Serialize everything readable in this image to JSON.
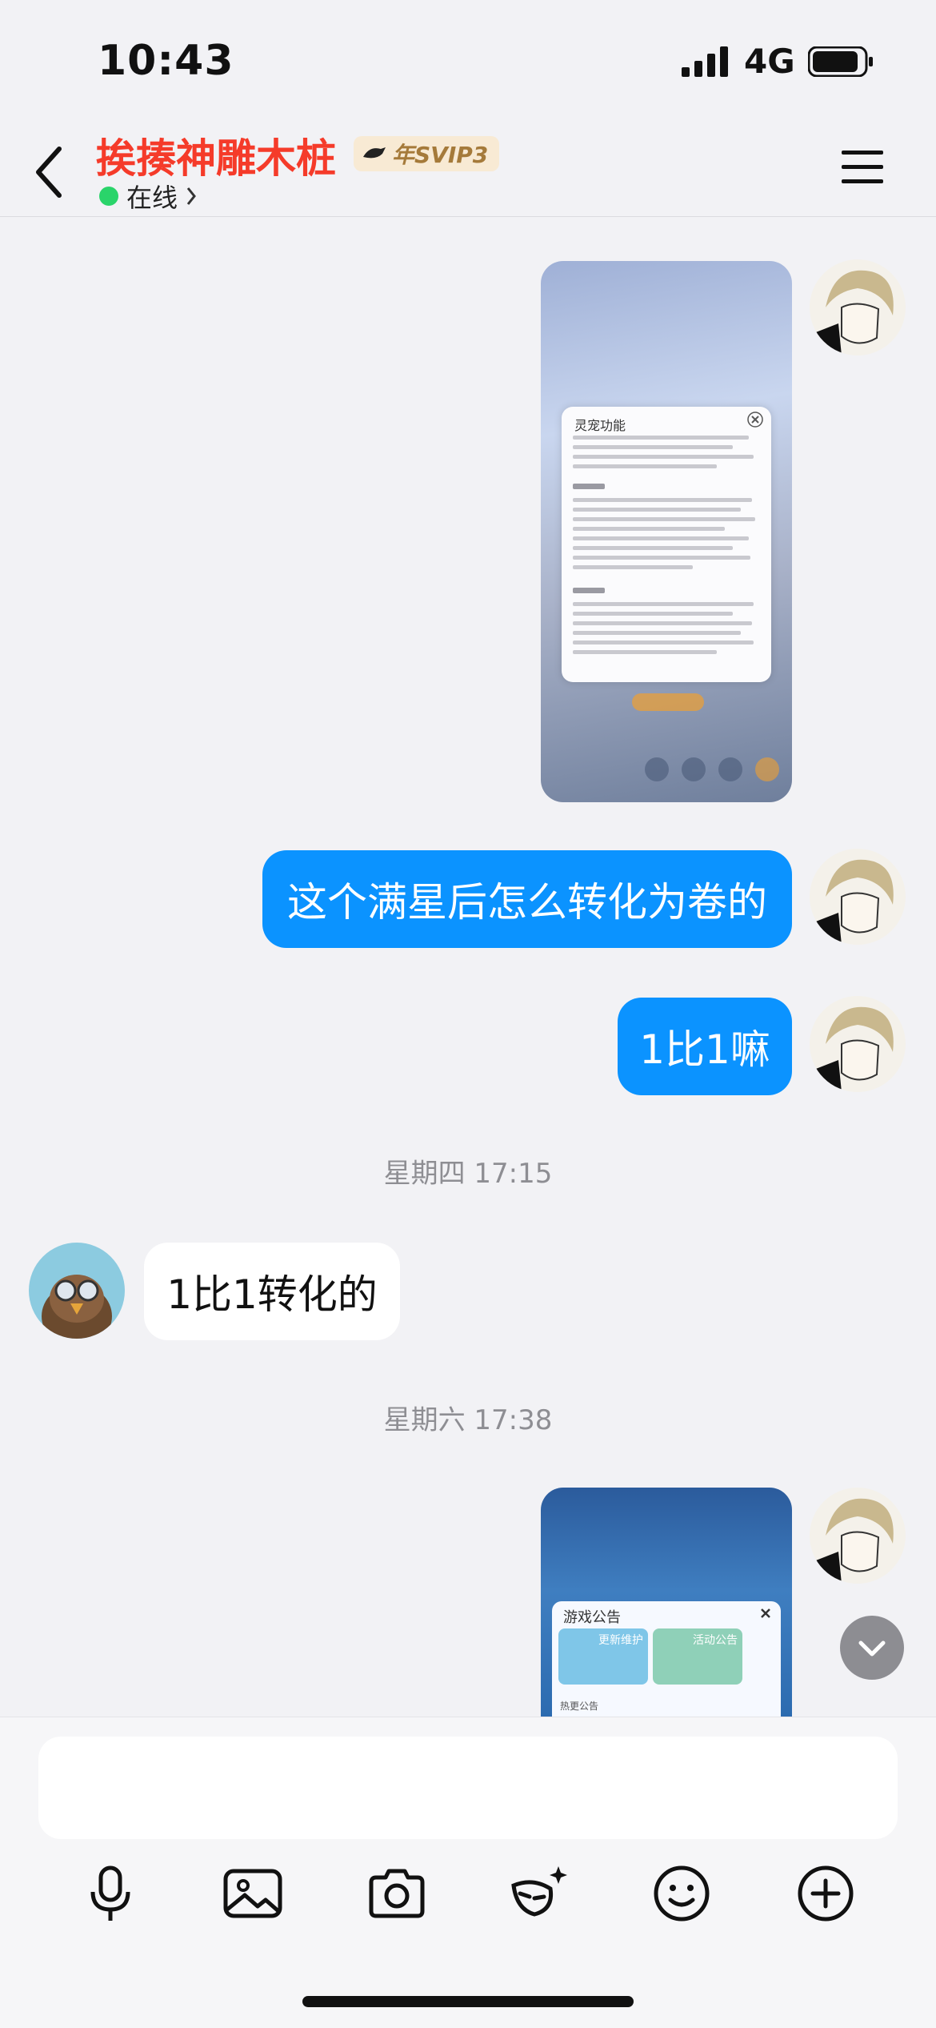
{
  "status_bar": {
    "time": "10:43",
    "network": "4G"
  },
  "nav": {
    "title": "挨揍神雕木桩",
    "badge": "年SVIP3",
    "presence": "在线"
  },
  "messages": {
    "m1": "这个满星后怎么转化为卷的",
    "m2": "1比1嘛",
    "ts1": "星期四 17:15",
    "m3": "1比1转化的",
    "ts2": "星期六 17:38"
  },
  "images": {
    "img1_panel_title": "灵宠功能",
    "img2_panel_title": "游戏公告",
    "img2_card1": "更新维护",
    "img2_card2": "活动公告",
    "img2_more": "热更公告"
  },
  "colors": {
    "title": "#f53b2a",
    "my_bubble": "#0b93ff",
    "online": "#2ad46a"
  }
}
